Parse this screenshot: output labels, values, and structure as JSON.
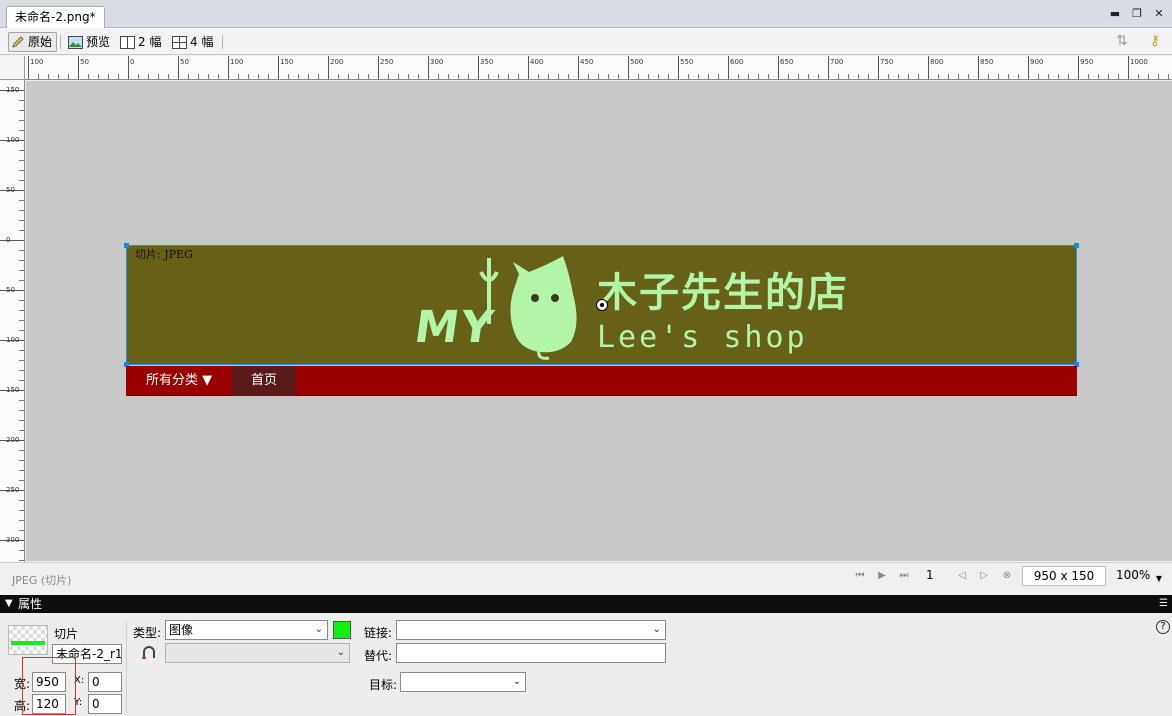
{
  "tab": {
    "title": "未命名-2.png*"
  },
  "window": {
    "minimize": "▬",
    "restore": "❐",
    "close": "✕"
  },
  "toolbar": {
    "original": "原始",
    "preview": "预览",
    "two_up": "2 幅",
    "four_up": "4 幅"
  },
  "ruler": {
    "top": [
      "100",
      "50",
      "0",
      "50",
      "100",
      "150",
      "200",
      "250",
      "300",
      "350",
      "400",
      "450",
      "500",
      "550",
      "600",
      "650",
      "700",
      "750",
      "800",
      "850",
      "900",
      "950",
      "1000"
    ],
    "left": [
      "150",
      "100",
      "50",
      "0",
      "50",
      "100",
      "150",
      "200",
      "250",
      "300"
    ]
  },
  "canvas": {
    "slice_label": "切片: JPEG",
    "logo_my": "MY",
    "logo_title": "木子先生的店",
    "logo_subtitle": "Lee's shop",
    "nav_all": "所有分类 ▼",
    "nav_home": "首页",
    "banner_color": "#676118",
    "nav_color": "#990000",
    "logo_color": "#b3f5a6"
  },
  "status": {
    "text": "JPEG (切片)",
    "page": "1",
    "dimensions": "950 x 150",
    "zoom": "100%"
  },
  "properties": {
    "header": "属性",
    "slice_label": "切片",
    "slice_name": "未命名-2_r1",
    "type_label": "类型:",
    "type_value": "图像",
    "link_label": "链接:",
    "link_value": "",
    "alt_label": "替代:",
    "alt_value": "",
    "target_label": "目标:",
    "target_value": "",
    "width_label": "宽:",
    "width_value": "950",
    "height_label": "高:",
    "height_value": "120",
    "x_label": "X:",
    "x_value": "0",
    "y_label": "Y:",
    "y_value": "0",
    "help": "?",
    "swatch_color": "#12f012"
  }
}
